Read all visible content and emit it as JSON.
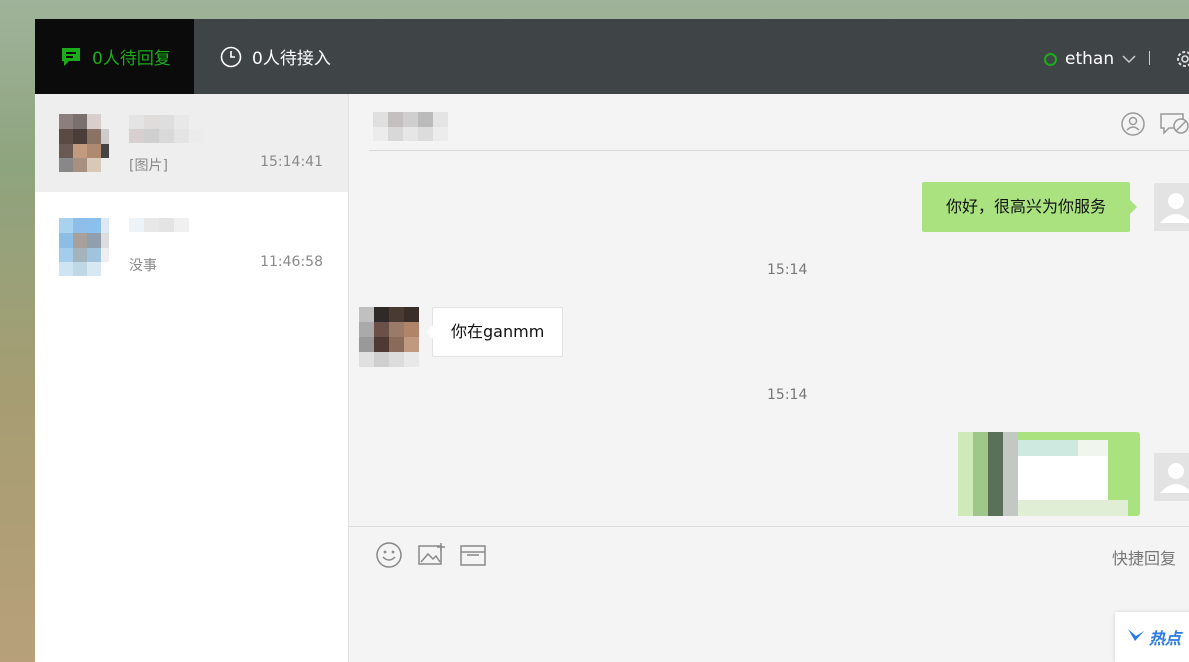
{
  "header": {
    "tabs": [
      {
        "label": "0人待回复",
        "icon": "chat-bubble-icon",
        "active": true
      },
      {
        "label": "0人待接入",
        "icon": "clock-icon",
        "active": false
      }
    ],
    "user": {
      "name": "ethan",
      "status_color": "#1aad19"
    }
  },
  "conversations": [
    {
      "last_message": "[图片]",
      "time": "15:14:41",
      "selected": true
    },
    {
      "last_message": "没事",
      "time": "11:46:58",
      "selected": false
    }
  ],
  "chat": {
    "messages": [
      {
        "type": "outgoing",
        "text": "你好，很高兴为你服务"
      },
      {
        "type": "timestamp",
        "text": "15:14"
      },
      {
        "type": "incoming",
        "text": "你在ganmm"
      },
      {
        "type": "timestamp",
        "text": "15:14"
      },
      {
        "type": "outgoing-image"
      }
    ]
  },
  "compose": {
    "quick_reply_label": "快捷回复"
  },
  "floating": {
    "hot_label": "热点"
  },
  "colors": {
    "accent": "#1aad19",
    "topbar": "#3f4447",
    "bubble_out": "#a9e27f"
  }
}
